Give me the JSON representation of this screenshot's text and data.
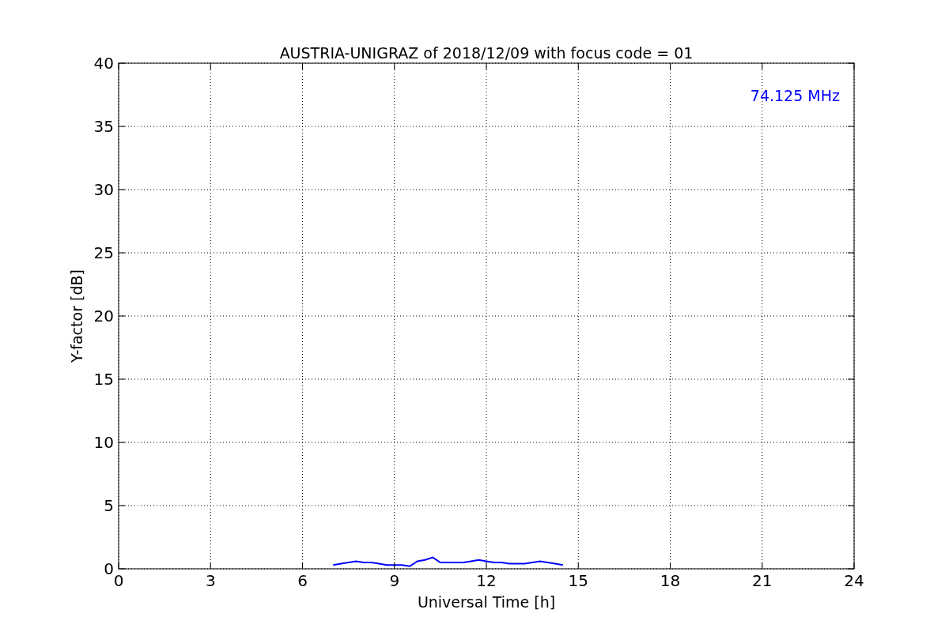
{
  "chart_data": {
    "type": "line",
    "title": "AUSTRIA-UNIGRAZ of 2018/12/09 with focus code = 01",
    "xlabel": "Universal Time [h]",
    "ylabel": "Y-factor [dB]",
    "x": [
      7.0,
      7.25,
      7.5,
      7.75,
      8.0,
      8.25,
      8.5,
      8.75,
      9.0,
      9.25,
      9.5,
      9.75,
      10.0,
      10.25,
      10.5,
      10.75,
      11.0,
      11.25,
      11.5,
      11.75,
      12.0,
      12.25,
      12.5,
      12.75,
      13.0,
      13.25,
      13.5,
      13.75,
      14.0,
      14.25,
      14.5
    ],
    "series": [
      {
        "name": "74.125 MHz",
        "color": "#0000ff",
        "values": [
          0.3,
          0.4,
          0.5,
          0.6,
          0.5,
          0.5,
          0.4,
          0.3,
          0.3,
          0.3,
          0.2,
          0.6,
          0.7,
          0.9,
          0.5,
          0.5,
          0.5,
          0.5,
          0.6,
          0.7,
          0.6,
          0.5,
          0.5,
          0.4,
          0.4,
          0.4,
          0.5,
          0.6,
          0.5,
          0.4,
          0.3
        ]
      }
    ],
    "xlim": [
      0,
      24
    ],
    "ylim": [
      0,
      40
    ],
    "xticks": [
      0,
      3,
      6,
      9,
      12,
      15,
      18,
      21,
      24
    ],
    "yticks": [
      0,
      5,
      10,
      15,
      20,
      25,
      30,
      35,
      40
    ],
    "grid": true
  }
}
